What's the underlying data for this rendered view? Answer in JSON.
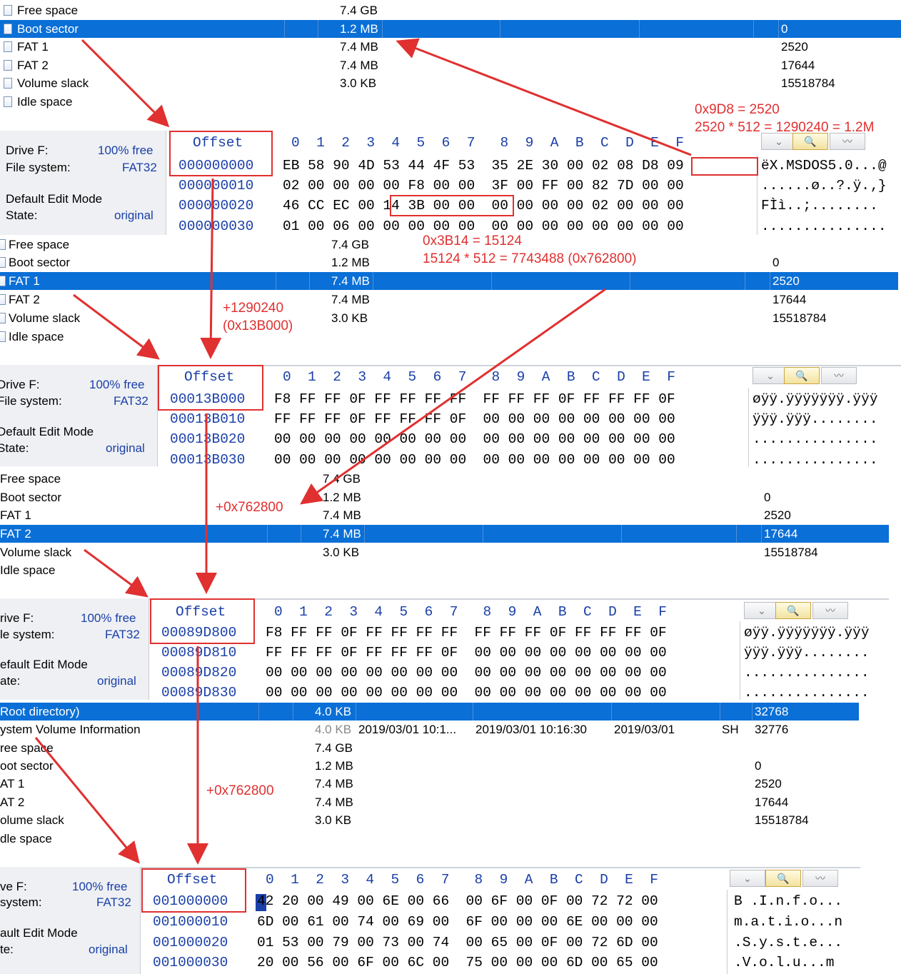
{
  "part_list_1": [
    {
      "name": "Free space",
      "size": "7.4 GB",
      "first": ""
    },
    {
      "name": "Boot sector",
      "size": "1.2 MB",
      "first": "0"
    },
    {
      "name": "FAT 1",
      "size": "7.4 MB",
      "first": "2520"
    },
    {
      "name": "FAT 2",
      "size": "7.4 MB",
      "first": "17644"
    },
    {
      "name": "Volume slack",
      "size": "3.0 KB",
      "first": "15518784"
    },
    {
      "name": "Idle space",
      "size": "",
      "first": ""
    }
  ],
  "part_list_2": [
    {
      "name": "Free space",
      "size": "7.4 GB",
      "first": ""
    },
    {
      "name": "Boot sector",
      "size": "1.2 MB",
      "first": "0"
    },
    {
      "name": "FAT 1",
      "size": "7.4 MB",
      "first": "2520"
    },
    {
      "name": "FAT 2",
      "size": "7.4 MB",
      "first": "17644"
    },
    {
      "name": "Volume slack",
      "size": "3.0 KB",
      "first": "15518784"
    },
    {
      "name": "Idle space",
      "size": "",
      "first": ""
    }
  ],
  "part_list_3": [
    {
      "name": "Free space",
      "size": "7.4 GB",
      "first": ""
    },
    {
      "name": "Boot sector",
      "size": "1.2 MB",
      "first": "0"
    },
    {
      "name": "FAT 1",
      "size": "7.4 MB",
      "first": "2520"
    },
    {
      "name": "FAT 2",
      "size": "7.4 MB",
      "first": "17644"
    },
    {
      "name": "Volume slack",
      "size": "3.0 KB",
      "first": "15518784"
    },
    {
      "name": "Idle space",
      "size": "",
      "first": ""
    }
  ],
  "part_list_4": [
    {
      "name": "Root directory)",
      "size": "4.0 KB",
      "d1": "",
      "d2": "",
      "d3": "",
      "attr": "",
      "first": "32768"
    },
    {
      "name": "ystem Volume Information",
      "size": "4.0 KB",
      "d1": "2019/03/01  10:1...",
      "d2": "2019/03/01  10:16:30",
      "d3": "2019/03/01",
      "attr": "SH",
      "first": "32776"
    },
    {
      "name": "ree space",
      "size": "7.4 GB",
      "d1": "",
      "d2": "",
      "d3": "",
      "attr": "",
      "first": ""
    },
    {
      "name": "oot sector",
      "size": "1.2 MB",
      "d1": "",
      "d2": "",
      "d3": "",
      "attr": "",
      "first": "0"
    },
    {
      "name": "AT 1",
      "size": "7.4 MB",
      "d1": "",
      "d2": "",
      "d3": "",
      "attr": "",
      "first": "2520"
    },
    {
      "name": "AT 2",
      "size": "7.4 MB",
      "d1": "",
      "d2": "",
      "d3": "",
      "attr": "",
      "first": "17644"
    },
    {
      "name": "olume slack",
      "size": "3.0 KB",
      "d1": "",
      "d2": "",
      "d3": "",
      "attr": "",
      "first": "15518784"
    },
    {
      "name": "dle space",
      "size": "",
      "d1": "",
      "d2": "",
      "d3": "",
      "attr": "",
      "first": ""
    }
  ],
  "hex_header": {
    "offset": "Offset",
    "cols": "0  1  2  3  4  5  6  7   8  9  A  B  C  D  E  F"
  },
  "panel_info": {
    "p1": {
      "drive": "Drive F:",
      "free": "100% free",
      "fs_label": "File system:",
      "fs": "FAT32",
      "mode": "Default Edit Mode",
      "state_label": "State:",
      "state": "original"
    },
    "p2": {
      "drive": "Drive F:",
      "free": "100% free",
      "fs_label": "File system:",
      "fs": "FAT32",
      "mode": "Default Edit Mode",
      "state_label": "State:",
      "state": "original"
    },
    "p3": {
      "drive": "rive F:",
      "free": "100% free",
      "fs_label": "le system:",
      "fs": "FAT32",
      "mode": "efault Edit Mode",
      "state_label": "ate:",
      "state": "original"
    },
    "p4": {
      "drive": "ve F:",
      "free": "100% free",
      "fs_label": "system:",
      "fs": "FAT32",
      "mode": "ault Edit Mode",
      "state_label": "te:",
      "state": "original"
    }
  },
  "hex_1": {
    "offsets": [
      "000000000",
      "000000010",
      "000000020",
      "000000030"
    ],
    "rows": [
      "EB 58 90 4D 53 44 4F 53  35 2E 30 00 02 08 D8 09",
      "02 00 00 00 00 F8 00 00  3F 00 FF 00 82 7D 00 00",
      "46 CC EC 00 14 3B 00 00  00 00 00 00 02 00 00 00",
      "01 00 06 00 00 00 00 00  00 00 00 00 00 00 00 00"
    ],
    "ascii": [
      "ëX.MSDOS5.0...@",
      "......ø..?.ÿ.‚}",
      "FÌì..;........",
      "..............."
    ]
  },
  "hex_2": {
    "offsets": [
      "00013B000",
      "00013B010",
      "00013B020",
      "00013B030"
    ],
    "rows": [
      "F8 FF FF 0F FF FF FF FF  FF FF FF 0F FF FF FF 0F",
      "FF FF FF 0F FF FF FF 0F  00 00 00 00 00 00 00 00",
      "00 00 00 00 00 00 00 00  00 00 00 00 00 00 00 00",
      "00 00 00 00 00 00 00 00  00 00 00 00 00 00 00 00"
    ],
    "ascii": [
      "øÿÿ.ÿÿÿÿÿÿÿ.ÿÿÿ",
      "ÿÿÿ.ÿÿÿ........",
      "...............",
      "..............."
    ]
  },
  "hex_3": {
    "offsets": [
      "00089D800",
      "00089D810",
      "00089D820",
      "00089D830"
    ],
    "rows": [
      "F8 FF FF 0F FF FF FF FF  FF FF FF 0F FF FF FF 0F",
      "FF FF FF 0F FF FF FF 0F  00 00 00 00 00 00 00 00",
      "00 00 00 00 00 00 00 00  00 00 00 00 00 00 00 00",
      "00 00 00 00 00 00 00 00  00 00 00 00 00 00 00 00"
    ],
    "ascii": [
      "øÿÿ.ÿÿÿÿÿÿÿ.ÿÿÿ",
      "ÿÿÿ.ÿÿÿ........",
      "...............",
      "..............."
    ]
  },
  "hex_4": {
    "offsets": [
      "001000000",
      "001000010",
      "001000020",
      "001000030"
    ],
    "rows": [
      "42 20 00 49 00 6E 00 66  00 6F 00 0F 00 72 72 00",
      "6D 00 61 00 74 00 69 00  6F 00 00 00 6E 00 00 00",
      "01 53 00 79 00 73 00 74  00 65 00 0F 00 72 6D 00",
      "20 00 56 00 6F 00 6C 00  75 00 00 00 6D 00 65 00"
    ],
    "ascii": [
      "B .I.n.f.o...",
      "m.a.t.i.o...n",
      ".S.y.s.t.e...",
      ".V.o.l.u...m"
    ]
  },
  "annotations": {
    "a1": "0x9D8 = 2520",
    "a2": "2520 * 512 = 1290240 = 1.2M",
    "a3": "0x3B14 = 15124",
    "a4": "15124 * 512 = 7743488 (0x762800)",
    "a5": "+1290240",
    "a6": "(0x13B000)",
    "a7": "+0x762800",
    "a8": "+0x762800"
  },
  "colors": {
    "selection": "#0a6fd6",
    "annotation": "#e03030",
    "hex_blue": "#1a3fa8"
  }
}
